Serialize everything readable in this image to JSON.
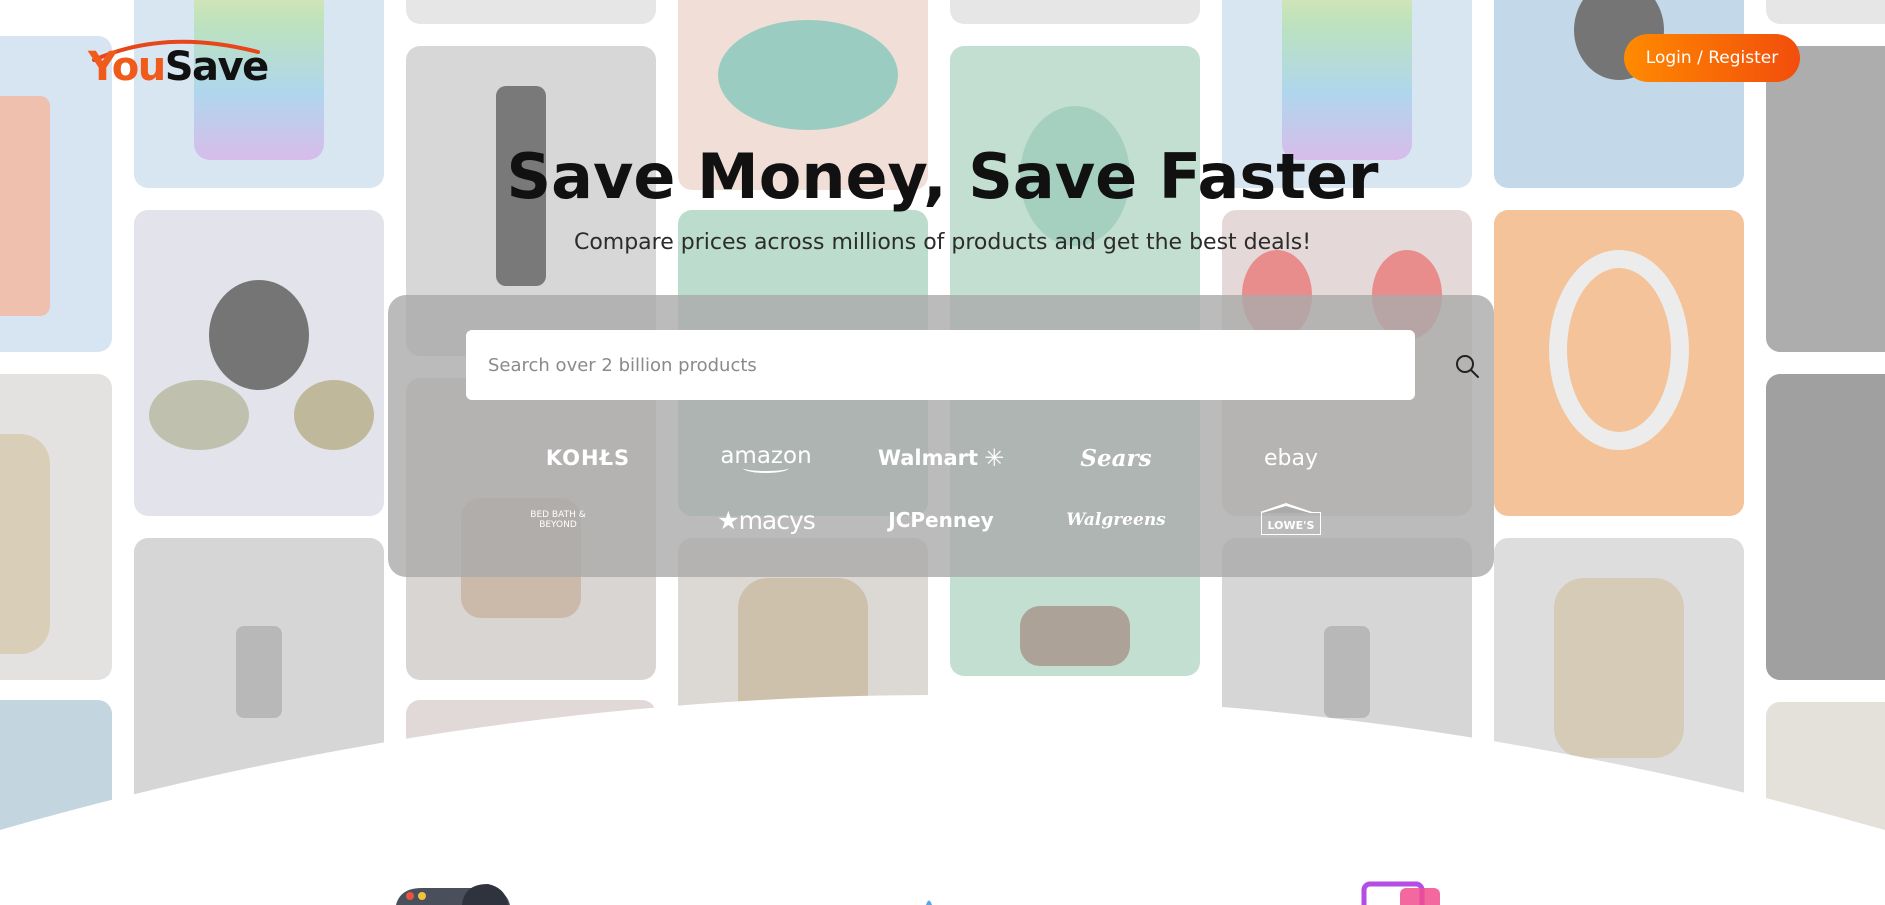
{
  "header": {
    "logo": {
      "part1": "You",
      "part2": "Save"
    },
    "login_label": "Login / Register"
  },
  "hero": {
    "title": "Save Money, Save Faster",
    "subtitle": "Compare prices across millions of products and get the best deals!"
  },
  "search": {
    "placeholder": "Search over 2 billion products",
    "value": "",
    "icon": "search-icon"
  },
  "stores": [
    {
      "name": "KOHL'S",
      "display": "KOHŁS"
    },
    {
      "name": "amazon",
      "display": "amazon"
    },
    {
      "name": "Walmart",
      "display": "Walmart"
    },
    {
      "name": "Sears",
      "display": "Sears"
    },
    {
      "name": "ebay",
      "display": "ebay"
    },
    {
      "name": "BED BATH & BEYOND",
      "display": "BED BATH & BEYOND"
    },
    {
      "name": "macys",
      "display": "★macys"
    },
    {
      "name": "JCPenney",
      "display": "JCPenney"
    },
    {
      "name": "Walgreens",
      "display": "Walgreens"
    },
    {
      "name": "LOWE'S",
      "display": "LOWE'S"
    }
  ],
  "colors": {
    "brand_orange": "#f05a1a",
    "button_gradient_start": "#ff8a00",
    "button_gradient_end": "#f24d0c",
    "panel": "#aaaaaa"
  },
  "background_tiles": [
    "luggage",
    "shoe",
    "smartwatch",
    "perfume-bottle",
    "watch",
    "headphones",
    "spray-bottle",
    "phone-charging",
    "stones",
    "wallet",
    "sneakers"
  ],
  "features": [
    "gamepad-icon",
    "rocket-icon",
    "shopping-cart-icon"
  ]
}
